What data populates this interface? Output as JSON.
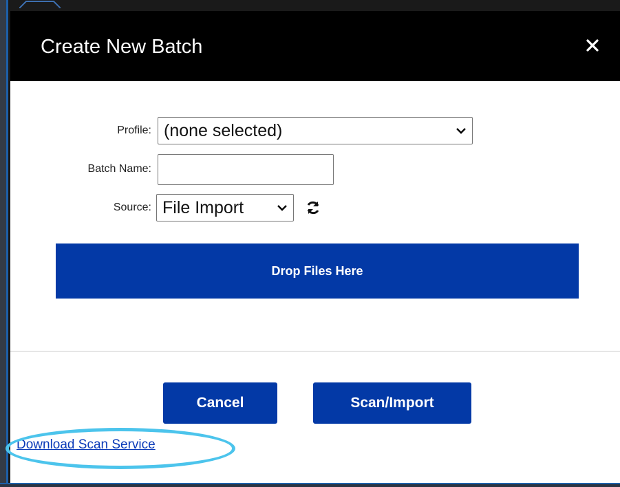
{
  "dialog": {
    "title": "Create New Batch",
    "close_icon": "close-icon"
  },
  "form": {
    "profile": {
      "label": "Profile:",
      "selected": "(none selected)"
    },
    "batch_name": {
      "label": "Batch Name:",
      "value": ""
    },
    "source": {
      "label": "Source:",
      "selected": "File Import",
      "refresh_icon": "refresh-icon"
    }
  },
  "drop_zone": {
    "label": "Drop Files Here"
  },
  "buttons": {
    "cancel": "Cancel",
    "scan_import": "Scan/Import"
  },
  "footer": {
    "download_link": "Download Scan Service"
  },
  "colors": {
    "accent": "#0339a6",
    "titlebar": "#000000",
    "highlight": "#4cc4ec",
    "link": "#0a3ab8"
  }
}
